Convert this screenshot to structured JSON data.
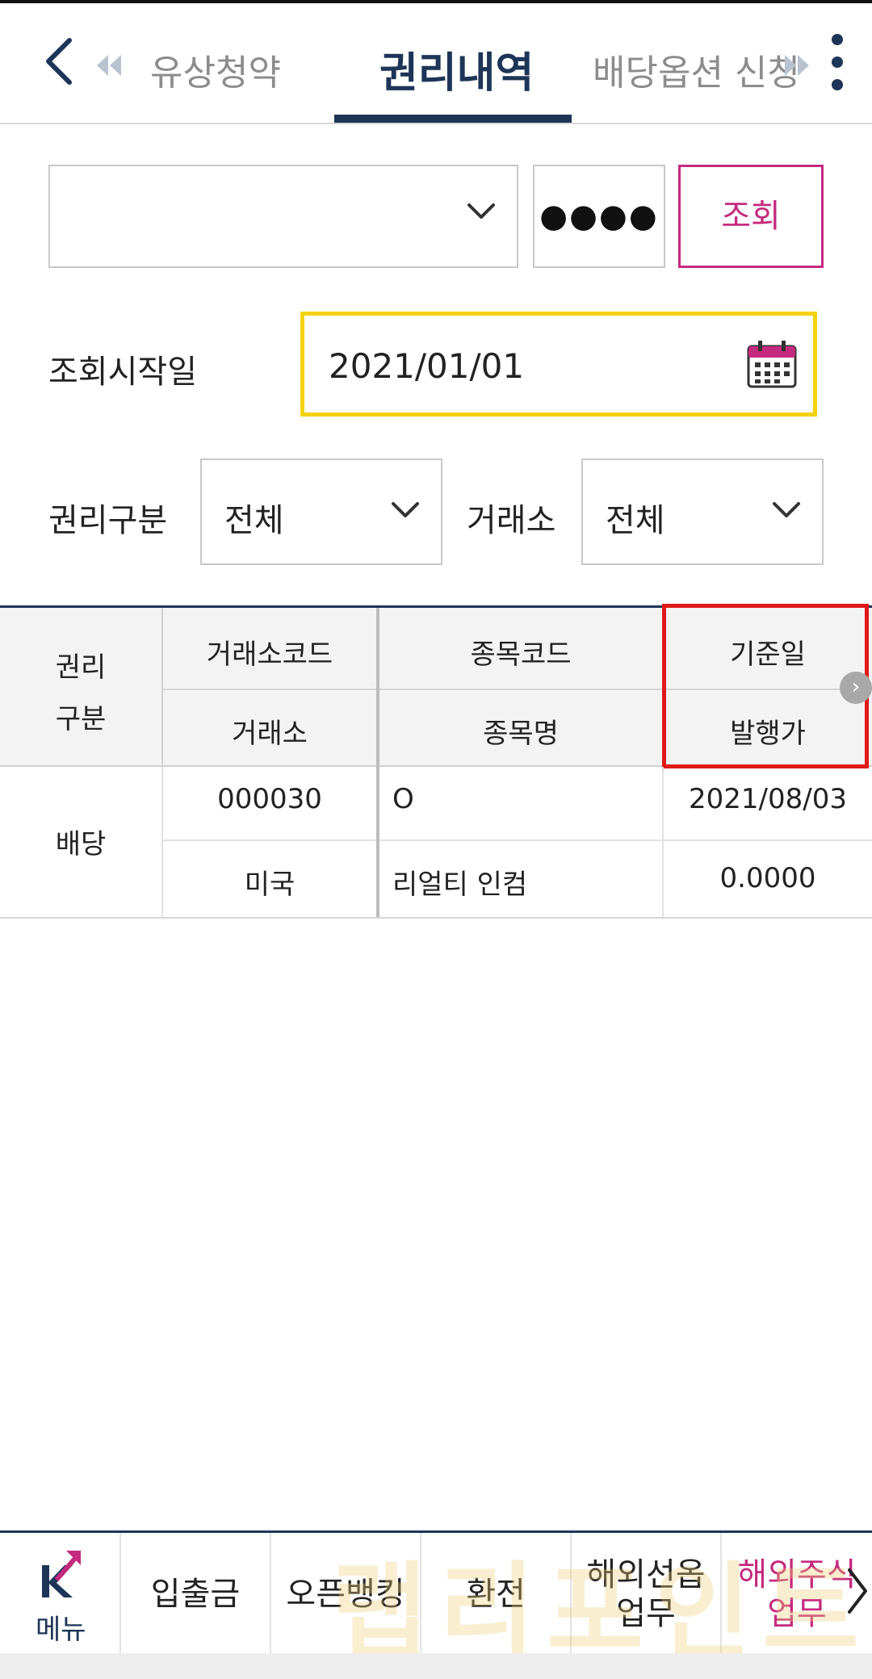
{
  "header": {
    "prev_tab": "유상청약",
    "active_tab": "권리내역",
    "next_tab": "배당옵션 신청"
  },
  "account": {
    "selected": "",
    "password_mask": "●●●●",
    "search_label": "조회"
  },
  "date_filter": {
    "label": "조회시작일",
    "value": "2021/01/01"
  },
  "filters": {
    "right_type_label": "권리구분",
    "right_type_value": "전체",
    "exchange_label": "거래소",
    "exchange_value": "전체"
  },
  "table": {
    "headers": {
      "right_type": "권리\n구분",
      "exchange_code": "거래소코드",
      "exchange": "거래소",
      "symbol_code": "종목코드",
      "symbol_name": "종목명",
      "base_date": "기준일",
      "issue_price": "발행가"
    },
    "rows": [
      {
        "right_type": "배당",
        "exchange_code": "000030",
        "exchange": "미국",
        "symbol_code": "O",
        "symbol_name": "리얼티 인컴",
        "base_date": "2021/08/03",
        "issue_price": "0.0000"
      }
    ]
  },
  "bottom_nav": {
    "menu_label": "메뉴",
    "items": [
      "입출금",
      "오픈뱅킹",
      "환전",
      "해외선옵\n업무",
      "해외주식\n업무"
    ]
  },
  "watermark": "랩리포인트",
  "colors": {
    "primary": "#1d3557",
    "accent": "#c42a7e",
    "date_highlight": "#f3d20c",
    "column_highlight": "#e01818"
  }
}
